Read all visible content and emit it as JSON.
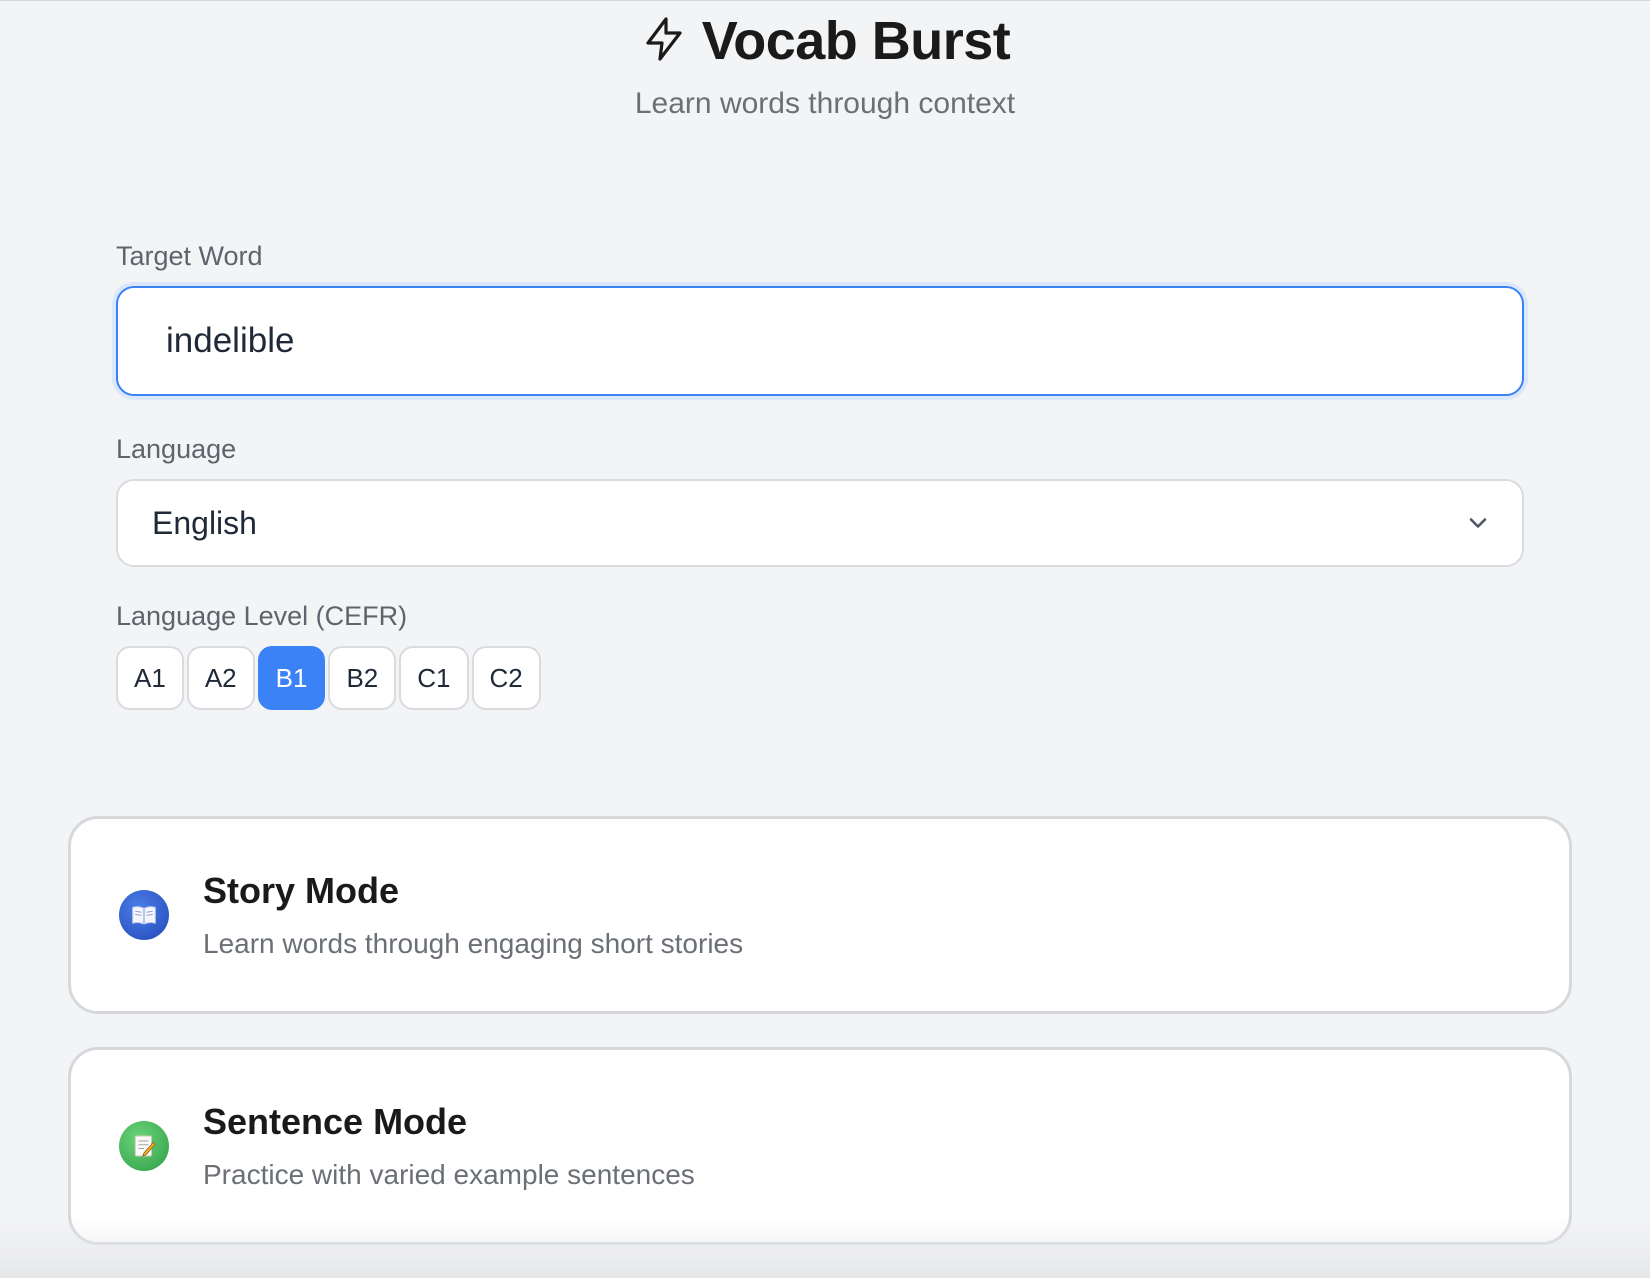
{
  "header": {
    "title": "Vocab Burst",
    "subtitle": "Learn words through context"
  },
  "form": {
    "target_word": {
      "label": "Target Word",
      "value": "indelible"
    },
    "language": {
      "label": "Language",
      "selected": "English"
    },
    "level": {
      "label": "Language Level (CEFR)",
      "options": [
        "A1",
        "A2",
        "B1",
        "B2",
        "C1",
        "C2"
      ],
      "selected": "B1"
    }
  },
  "modes": [
    {
      "icon": "open-book-icon",
      "title": "Story Mode",
      "description": "Learn words through engaging short stories"
    },
    {
      "icon": "memo-pencil-icon",
      "title": "Sentence Mode",
      "description": "Practice with varied example sentences"
    }
  ],
  "colors": {
    "accent": "#3b82f6",
    "background": "#f3f4f6"
  }
}
